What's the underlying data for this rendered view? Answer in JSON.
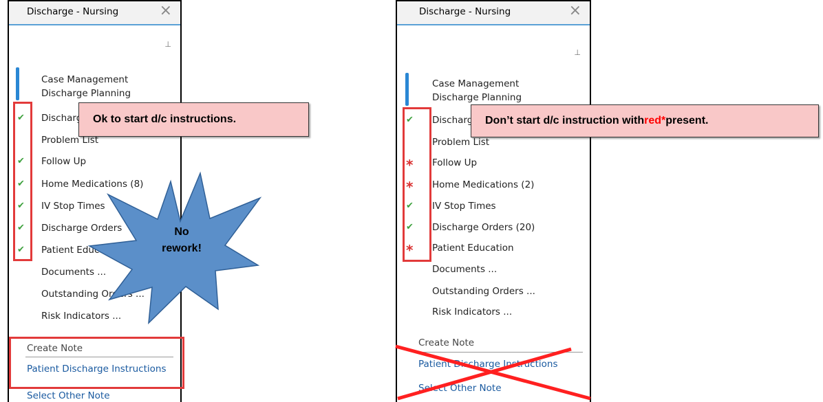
{
  "left": {
    "tab_title": "Discharge - Nursing",
    "close_glyph": "×",
    "pin_glyph": "⊥",
    "case_management": "Case Management Discharge Planning",
    "items": [
      {
        "label": "Discharge",
        "status": "check"
      },
      {
        "label": "Problem List",
        "status": "none"
      },
      {
        "label": "Follow Up",
        "status": "check"
      },
      {
        "label": "Home Medications (8)",
        "status": "check"
      },
      {
        "label": "IV Stop Times",
        "status": "check"
      },
      {
        "label": "Discharge Orders",
        "status": "check"
      },
      {
        "label": "Patient Education",
        "status": "check"
      },
      {
        "label": "Documents ...",
        "status": "none"
      },
      {
        "label": "Outstanding Orders ...",
        "status": "none"
      },
      {
        "label": "Risk Indicators ...",
        "status": "none"
      }
    ],
    "create_note": "Create Note",
    "patient_discharge_instructions": "Patient Discharge Instructions",
    "select_other_note": "Select Other Note",
    "callout": "Ok to start d/c instructions.",
    "burst_line1": "No",
    "burst_line2": "rework!"
  },
  "right": {
    "tab_title": "Discharge - Nursing",
    "close_glyph": "×",
    "pin_glyph": "⊥",
    "case_management": "Case Management Discharge Planning",
    "items": [
      {
        "label": "Discharge",
        "status": "check"
      },
      {
        "label": "Problem List",
        "status": "none"
      },
      {
        "label": "Follow Up",
        "status": "required"
      },
      {
        "label": "Home Medications (2)",
        "status": "required"
      },
      {
        "label": "IV Stop Times",
        "status": "check"
      },
      {
        "label": "Discharge Orders (20)",
        "status": "check"
      },
      {
        "label": "Patient Education",
        "status": "required"
      },
      {
        "label": "Documents ...",
        "status": "none"
      },
      {
        "label": "Outstanding Orders ...",
        "status": "none"
      },
      {
        "label": "Risk Indicators ...",
        "status": "none"
      }
    ],
    "create_note": "Create Note",
    "patient_discharge_instructions": "Patient Discharge Instructions",
    "select_other_note": "Select Other Note",
    "callout_prefix": "Don’t start d/c instruction with ",
    "callout_red": "red*",
    "callout_suffix": " present."
  },
  "glyphs": {
    "check": "✔",
    "required": "*"
  },
  "colors": {
    "check": "#3ea13e",
    "required": "#d93030",
    "highlight_box": "#e23a3a",
    "callout_bg": "#f9c8c8",
    "burst_fill": "#5b8fc9",
    "tab_accent": "#2a87d4",
    "link": "#1a5aa0"
  }
}
